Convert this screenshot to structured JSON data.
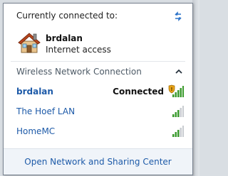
{
  "status": {
    "title": "Currently connected to:",
    "network_name": "brdalan",
    "network_status": "Internet access"
  },
  "section": {
    "title": "Wireless Network Connection"
  },
  "networks": [
    {
      "name": "brdalan",
      "state": "Connected",
      "bars": 5,
      "secured": true
    },
    {
      "name": "The Hoef LAN",
      "state": "",
      "bars": 3,
      "secured": false
    },
    {
      "name": "HomeMC",
      "state": "",
      "bars": 3,
      "secured": false
    }
  ],
  "footer": {
    "link": "Open Network and Sharing Center"
  },
  "colors": {
    "link": "#1d5aa8",
    "signal_on": "#3a9a2c",
    "signal_off": "#c8ccd0",
    "shield": "#e8a317"
  },
  "icons": {
    "refresh": "refresh-icon",
    "home": "home-network-icon",
    "collapse": "chevron-up-icon",
    "signal": "wifi-signal-icon"
  }
}
